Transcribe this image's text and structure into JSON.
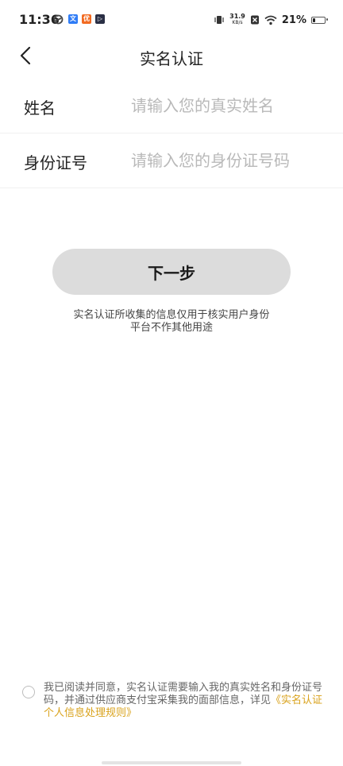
{
  "status_bar": {
    "time": "11:36",
    "net_speed_value": "31.9",
    "net_speed_unit": "KB/s",
    "battery_percent": "21%",
    "battery_level": 0.21
  },
  "nav": {
    "title": "实名认证"
  },
  "form": {
    "name_label": "姓名",
    "name_placeholder": "请输入您的真实姓名",
    "id_label": "身份证号",
    "id_placeholder": "请输入您的身份证号码"
  },
  "next_button": {
    "label": "下一步"
  },
  "notice": {
    "line1": "实名认证所收集的信息仅用于核实用户身份",
    "line2": "平台不作其他用途"
  },
  "agreement": {
    "text": "我已阅读并同意，实名认证需要输入我的真实姓名和身份证号码，并通过供应商支付宝采集我的面部信息，详见",
    "link": "《实名认证个人信息处理规则》"
  },
  "colors": {
    "link": "#d9a21b",
    "button_bg": "#dcdcdc"
  }
}
